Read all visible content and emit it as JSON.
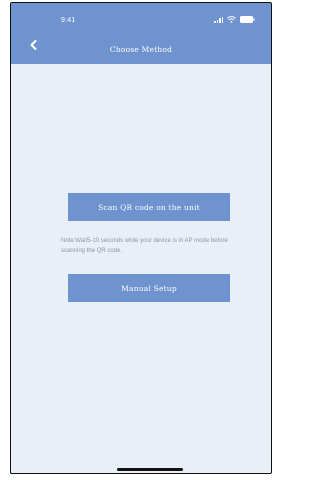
{
  "status_bar": {
    "time": "9:41"
  },
  "header": {
    "title": "Choose Method",
    "back_icon": "chevron-left-icon"
  },
  "main": {
    "scan_button_label": "Scan QR code on the unit",
    "note_text": "Note:Wait5-10 seconds while your device is in AP mode before scanning the QR code.",
    "manual_button_label": "Manual Setup"
  },
  "colors": {
    "accent": "#6e93cf",
    "background": "#e9eff7",
    "note_text": "#8a96a8"
  }
}
